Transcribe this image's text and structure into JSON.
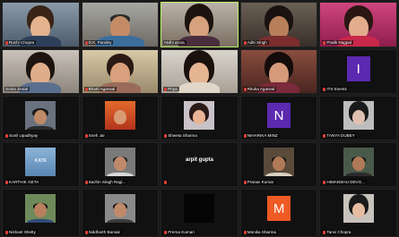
{
  "participants": [
    {
      "name": "Ruchi Chopra",
      "speaking": false
    },
    {
      "name": "D.K. Pandey",
      "speaking": false
    },
    {
      "name": "Nidhi arora",
      "speaking": true
    },
    {
      "name": "Aditi Singh",
      "speaking": false
    },
    {
      "name": "Pratik Nagpal",
      "speaking": false
    },
    {
      "name": "Sonia Jindal",
      "speaking": false
    },
    {
      "name": "Bharti Agarwal",
      "speaking": false
    },
    {
      "name": "Priya",
      "speaking": false
    },
    {
      "name": "Rituka Agarwal",
      "speaking": false
    },
    {
      "name": "I",
      "avatar_letter": "I",
      "label": "ITS Events",
      "speaking": false
    },
    {
      "name": "Sunil Upadhyay",
      "speaking": false
    },
    {
      "name": "Sneh Jai",
      "speaking": false
    },
    {
      "name": "Shweta Sharma",
      "speaking": false
    },
    {
      "name": "N",
      "avatar_letter": "N",
      "label": "NIHARIKA MINZ",
      "speaking": false
    },
    {
      "name": "TANYA DUBEY",
      "speaking": false
    },
    {
      "name": "KARTHIK GETA",
      "speaking": false
    },
    {
      "name": "Sachin Singh Ragi...",
      "speaking": false
    },
    {
      "name": "arpit gupta",
      "speaking": false
    },
    {
      "name": "Pranav Kumar",
      "speaking": false
    },
    {
      "name": "HIMANSHU DEVG...",
      "speaking": false
    },
    {
      "name": "Nishant Shetty",
      "speaking": false
    },
    {
      "name": "Siddharth Bansal",
      "speaking": false
    },
    {
      "name": "Prerna Kumari",
      "speaking": false
    },
    {
      "name": "M",
      "avatar_letter": "M",
      "label": "Monika Sharma",
      "speaking": false
    },
    {
      "name": "Tanvi Chopra",
      "speaking": false
    }
  ],
  "colors": {
    "speaking_border": "#b9f46a",
    "avatar_I": "#5b2ab0",
    "avatar_N": "#5b2ab0",
    "avatar_M": "#f05a24",
    "muted_mic": "#e0413a"
  },
  "icons": {
    "mic": "mic-muted-icon"
  }
}
